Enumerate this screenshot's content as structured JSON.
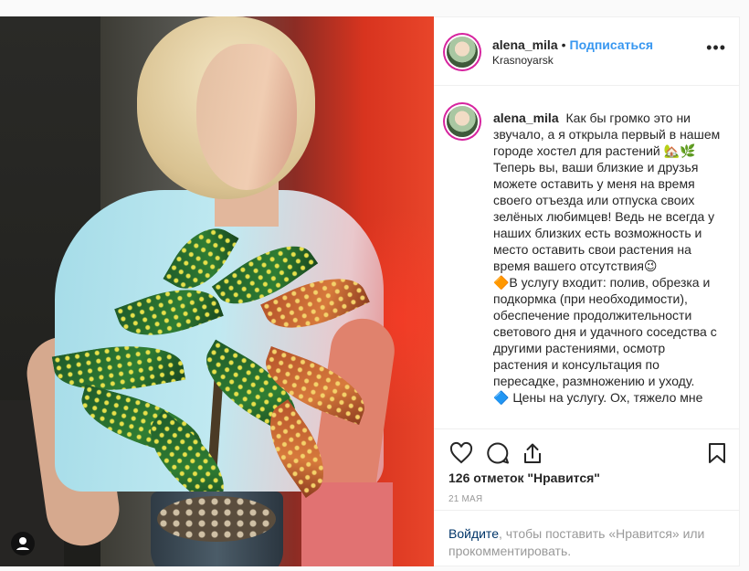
{
  "post": {
    "username": "alena_mila",
    "separator": "•",
    "follow_label": "Подписаться",
    "location": "Krasnoyarsk",
    "more_glyph": "•••",
    "caption": "Как бы громко это ни звучало, а я открыла первый в нашем городе хостел для растений 🏡🌿\nТеперь вы, ваши близкие и друзья можете оставить у меня на время своего отъезда или отпуска своих зелёных любимцев! Ведь не всегда у наших близких есть возможность и место оставить свои растения на время вашего отсутствия😉\n🔶В услугу входит: полив, обрезка и подкормка (при необходимости), обеспечение продолжительности светового дня и удачного соседства с другими растениями, осмотр растения и консультация по пересадке, размножению и уходу.\n🔷 Цены на услугу. Ох, тяжело мне",
    "likes": "126 отметок \"Нравится\"",
    "date": "21 МАЯ",
    "login_link": "Войдите",
    "login_rest": ", чтобы поставить «Нравится» или прокомментировать."
  },
  "icons": {
    "like": "heart-icon",
    "comment": "comment-icon",
    "share": "share-icon",
    "save": "bookmark-icon",
    "user": "user-icon"
  },
  "colors": {
    "accent": "#3897f0",
    "text": "#262626",
    "muted": "#999999",
    "link": "#003569"
  }
}
